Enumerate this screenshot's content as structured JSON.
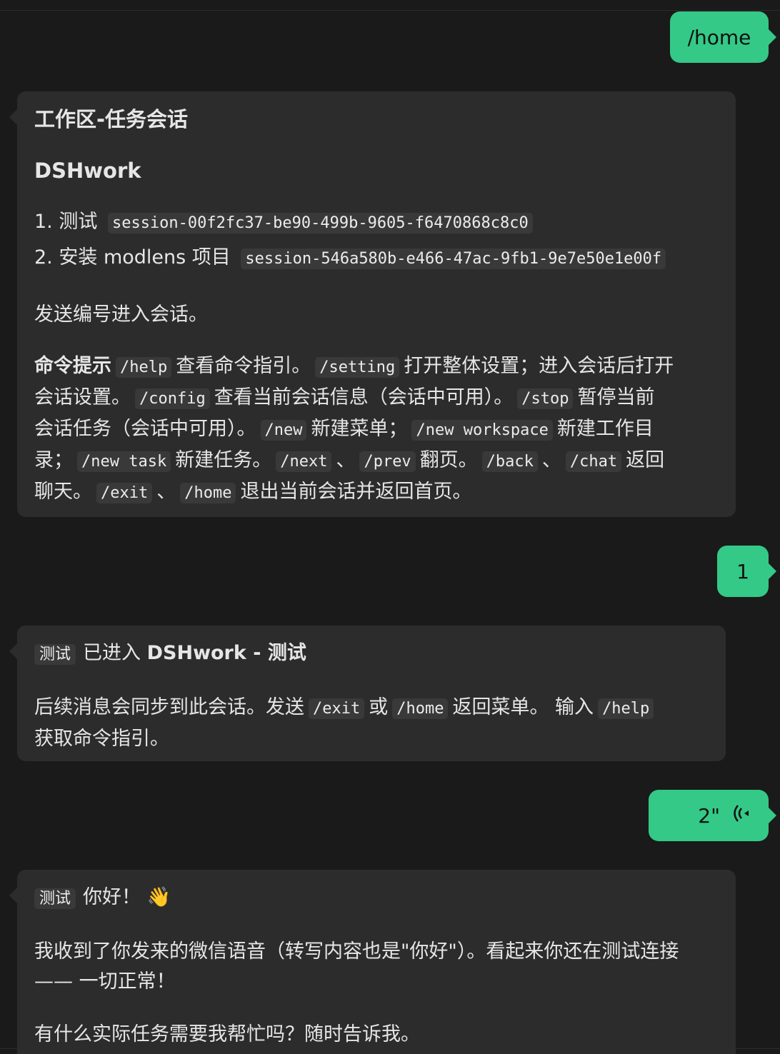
{
  "messages": {
    "user1": {
      "text": "/home"
    },
    "bot1": {
      "title": "工作区-任务会话",
      "workspace": "DSHwork",
      "sessions": [
        {
          "num": "1.",
          "name": "测试",
          "id": "session-00f2fc37-be90-499b-9605-f6470868c8c0"
        },
        {
          "num": "2.",
          "name": "安装 modlens 项目",
          "id": "session-546a580b-e466-47ac-9fb1-9e7e50e1e00f"
        }
      ],
      "prompt": "发送编号进入会话。",
      "cmd": {
        "label": "命令提示",
        "c_help": "/help",
        "t_help": "查看命令指引。",
        "c_setting": "/setting",
        "t_setting_a": "打开整体设置；进入会话后打开",
        "t_setting_b": "会话设置。",
        "c_config": "/config",
        "t_config": "查看当前会话信息（会话中可用）。",
        "c_stop": "/stop",
        "t_stop_a": "暂停当前",
        "t_stop_b": "会话任务（会话中可用）。",
        "c_new": "/new",
        "t_new": "新建菜单；",
        "c_new_ws": "/new workspace",
        "t_new_ws_a": "新建工作目",
        "t_new_ws_b": "录；",
        "c_new_task": "/new task",
        "t_new_task": "新建任务。",
        "c_next": "/next",
        "sep1": "、",
        "c_prev": "/prev",
        "t_page": "翻页。",
        "c_back": "/back",
        "sep2": "、",
        "c_chat": "/chat",
        "t_back_a": "返回",
        "t_back_b": "聊天。",
        "c_exit": "/exit",
        "sep3": "、",
        "c_home": "/home",
        "t_exit": "退出当前会话并返回首页。"
      }
    },
    "user2": {
      "text": "1"
    },
    "bot2": {
      "tag": "测试",
      "title_a": "已进入",
      "title_b": "DSHwork - 测试",
      "body_a": "后续消息会同步到此会话。发送",
      "c_exit": "/exit",
      "or": "或",
      "c_home": "/home",
      "body_b": "返回菜单。 输入",
      "c_help": "/help",
      "body_c": "获取命令指引。"
    },
    "user3": {
      "text": "2\"",
      "icon": "voice-wave-icon"
    },
    "bot3": {
      "tag": "测试",
      "greeting": "你好！",
      "emoji": "👋",
      "line1": "我收到了你发来的微信语音（转写内容也是\"你好\"）。看起来你还在测试连接",
      "line2": "—— 一切正常！",
      "line3": "有什么实际任务需要我帮忙吗？随时告诉我。"
    }
  }
}
